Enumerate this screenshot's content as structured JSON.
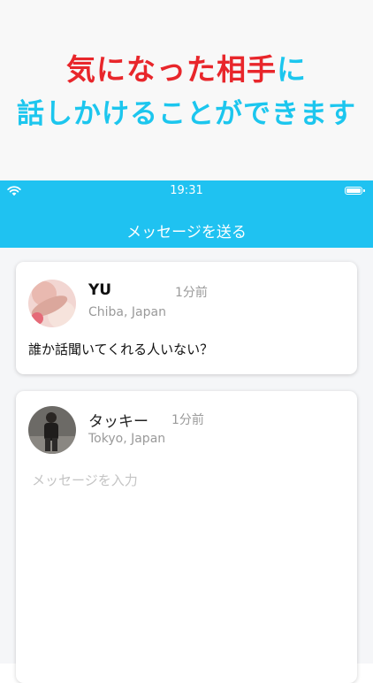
{
  "promo": {
    "line1_highlight": "気になった相手",
    "line1_rest": "に",
    "line2": "話しかけることができます"
  },
  "status_bar": {
    "time": "19:31",
    "icons": [
      "wifi-icon",
      "battery-icon"
    ]
  },
  "nav": {
    "title": "メッセージを送る"
  },
  "received_post": {
    "username": "YU",
    "time_ago": "1分前",
    "location": "Chiba, Japan",
    "message": "誰か話聞いてくれる人いない？"
  },
  "reply": {
    "username": "タッキー",
    "time_ago": "1分前",
    "location": "Tokyo, Japan",
    "input_placeholder": "メッセージを入力",
    "input_value": ""
  },
  "colors": {
    "accent": "#1fc2f1",
    "promo_red": "#e8262b",
    "promo_cyan": "#1cc6ee"
  }
}
